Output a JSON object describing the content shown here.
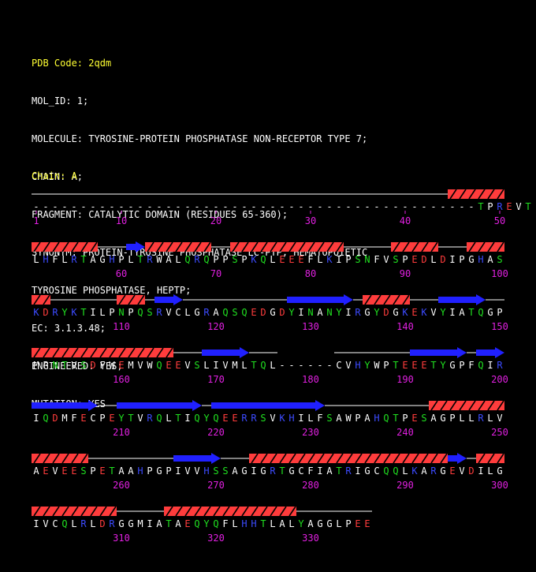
{
  "header": {
    "pdb_code": "PDB Code: 2qdm",
    "lines": [
      "MOL_ID: 1;",
      "MOLECULE: TYROSINE-PROTEIN PHOSPHATASE NON-RECEPTOR TYPE 7;",
      "CHAIN: A;",
      "FRAGMENT: CATALYTIC DOMAIN (RESIDUES 65-360);",
      "SYNONYM: PROTEIN-TYROSINE PHOSPHATASE LC-PTP, HEMATOPOIETIC",
      "TYROSINE PHOSPHATASE, HEPTP;",
      "EC: 3.1.3.48;",
      "ENGINEERED: YES;",
      "MUTATION: YES"
    ],
    "chain_label": "Chain: A"
  },
  "colors": {
    "positive": "#3c4bff",
    "negative": "#ff3c3c",
    "hydrophobic": "#ffffff",
    "polar": "#20e020",
    "gap": "#ffffff",
    "helix": "#ff3c3c",
    "strand": "#2020ff",
    "coil": "#ffffff",
    "numbers": "#e020e0"
  },
  "sequence": {
    "rows": [
      {
        "residues": "-----------------------------------------------TPREVT",
        "ticks": [
          {
            "label": "1",
            "pos": 0
          },
          {
            "label": "10",
            "pos": 9
          },
          {
            "label": "20",
            "pos": 19
          },
          {
            "label": "30",
            "pos": 29
          },
          {
            "label": "40",
            "pos": 39
          },
          {
            "label": "50",
            "pos": 49
          }
        ],
        "ss": [
          [
            "coil",
            0,
            44
          ],
          [
            "H",
            44,
            50
          ]
        ]
      },
      {
        "residues": "LHFLRTAGHPLTRWALQRQPPSPKQLEEEFLKIPSNFVSPEDLDIPGHAS",
        "ticks": [
          {
            "label": "60",
            "pos": 9
          },
          {
            "label": "70",
            "pos": 19
          },
          {
            "label": "80",
            "pos": 29
          },
          {
            "label": "90",
            "pos": 39
          },
          {
            "label": "100",
            "pos": 49
          }
        ],
        "ss": [
          [
            "H",
            0,
            7
          ],
          [
            "coil",
            7,
            10
          ],
          [
            "E",
            10,
            12
          ],
          [
            "H",
            12,
            19
          ],
          [
            "coil",
            19,
            21
          ],
          [
            "H",
            21,
            33
          ],
          [
            "coil",
            33,
            38
          ],
          [
            "H",
            38,
            43
          ],
          [
            "coil",
            43,
            46
          ],
          [
            "H",
            46,
            50
          ]
        ]
      },
      {
        "residues": "KDRYKTILPNPQSRVCLGRAQSQEDGDYINANYIRGYDGKEKVYIATQGP",
        "ticks": [
          {
            "label": "110",
            "pos": 9
          },
          {
            "label": "120",
            "pos": 19
          },
          {
            "label": "130",
            "pos": 29
          },
          {
            "label": "140",
            "pos": 39
          },
          {
            "label": "150",
            "pos": 49
          }
        ],
        "ss": [
          [
            "H",
            0,
            2
          ],
          [
            "coil",
            2,
            9
          ],
          [
            "H",
            9,
            12
          ],
          [
            "coil",
            12,
            13
          ],
          [
            "E",
            13,
            16
          ],
          [
            "coil",
            16,
            27
          ],
          [
            "E",
            27,
            34
          ],
          [
            "coil",
            34,
            35
          ],
          [
            "H",
            35,
            40
          ],
          [
            "coil",
            40,
            43
          ],
          [
            "E",
            43,
            48
          ],
          [
            "coil",
            48,
            50
          ]
        ]
      },
      {
        "residues": "MPNTVSDFWEMVWQEEVSLIVMLTQL------CVHYWPTEEETYGPFQIR",
        "ticks": [
          {
            "label": "160",
            "pos": 9
          },
          {
            "label": "170",
            "pos": 19
          },
          {
            "label": "180",
            "pos": 29
          },
          {
            "label": "190",
            "pos": 39
          },
          {
            "label": "200",
            "pos": 49
          }
        ],
        "ss": [
          [
            "H",
            0,
            15
          ],
          [
            "coil",
            15,
            18
          ],
          [
            "E",
            18,
            23
          ],
          [
            "coil",
            23,
            26
          ],
          [
            "coil",
            32,
            40
          ],
          [
            "E",
            40,
            46
          ],
          [
            "coil",
            46,
            47
          ],
          [
            "E",
            47,
            50
          ]
        ]
      },
      {
        "residues": "IQDMFECPEYTVRQLTIQYQEERRSVKHILFSAWPAHQTPESAGPLLRLV",
        "ticks": [
          {
            "label": "210",
            "pos": 9
          },
          {
            "label": "220",
            "pos": 19
          },
          {
            "label": "230",
            "pos": 29
          },
          {
            "label": "240",
            "pos": 39
          },
          {
            "label": "250",
            "pos": 49
          }
        ],
        "ss": [
          [
            "E",
            0,
            7
          ],
          [
            "coil",
            7,
            9
          ],
          [
            "E",
            9,
            18
          ],
          [
            "coil",
            18,
            19
          ],
          [
            "E",
            19,
            31
          ],
          [
            "coil",
            31,
            42
          ],
          [
            "H",
            42,
            50
          ]
        ]
      },
      {
        "residues": "AEVEESPETAAHPGPIVVHSSAGIGRTGCFIATRIGCQQLKARGEVDILG",
        "ticks": [
          {
            "label": "260",
            "pos": 9
          },
          {
            "label": "270",
            "pos": 19
          },
          {
            "label": "280",
            "pos": 29
          },
          {
            "label": "290",
            "pos": 39
          },
          {
            "label": "300",
            "pos": 49
          }
        ],
        "ss": [
          [
            "H",
            0,
            6
          ],
          [
            "coil",
            6,
            15
          ],
          [
            "E",
            15,
            20
          ],
          [
            "coil",
            20,
            23
          ],
          [
            "H",
            23,
            44
          ],
          [
            "E",
            44,
            46
          ],
          [
            "coil",
            46,
            47
          ],
          [
            "H",
            47,
            50
          ]
        ]
      },
      {
        "residues": "IVCQLRLDRGGMIATAEQYQFLHHTLALYAGGLPEE",
        "ticks": [
          {
            "label": "310",
            "pos": 9
          },
          {
            "label": "320",
            "pos": 19
          },
          {
            "label": "330",
            "pos": 29
          }
        ],
        "ss": [
          [
            "H",
            0,
            9
          ],
          [
            "coil",
            9,
            14
          ],
          [
            "H",
            14,
            28
          ],
          [
            "coil",
            28,
            36
          ]
        ]
      }
    ]
  }
}
